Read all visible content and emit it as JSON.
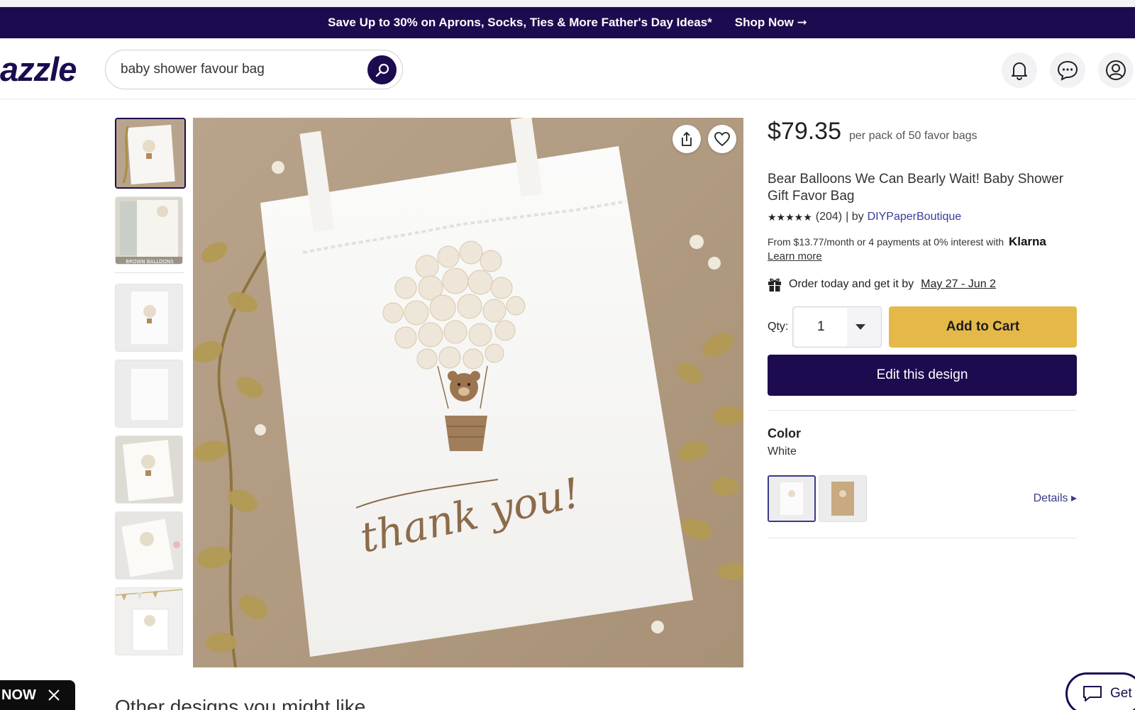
{
  "promo": {
    "text": "Save Up to 30% on Aprons, Socks, Ties & More Father's Day Ideas*",
    "shop_label": "Shop Now ➞"
  },
  "header": {
    "logo": "azzle",
    "search": {
      "value": "baby shower favour bag"
    },
    "icons": [
      "bell-icon",
      "chat-icon",
      "account-icon"
    ]
  },
  "gallery": {
    "thumbnail_count": 7,
    "active_index": 0,
    "thumb2_caption": "BROWN BALLOONS"
  },
  "product_image": {
    "script_text": "thank you!"
  },
  "product": {
    "price": "$79.35",
    "price_note": "per pack of 50 favor bags",
    "title": "Bear Balloons We Can Bearly Wait! Baby Shower Gift Favor Bag",
    "stars": "★★★★★",
    "review_count": "(204)",
    "by_label": "| by",
    "seller": "DIYPaperBoutique",
    "klarna_text": "From $13.77/month or 4 payments at 0% interest with",
    "klarna_logo": "Klarna",
    "learn_more": "Learn more",
    "delivery_text": "Order today and get it by",
    "delivery_date": "May 27 - Jun 2",
    "qty_label": "Qty:",
    "qty_value": "1",
    "add_to_cart": "Add to Cart",
    "edit_design": "Edit this design",
    "color_title": "Color",
    "color_value": "White",
    "details_label": "Details ▸"
  },
  "footer": {
    "section_title": "Other designs you might like",
    "now_badge": "NOW",
    "get_label": "Get"
  },
  "colors": {
    "brand": "#1d0b4f",
    "cart": "#e5b949",
    "backdrop": "#b49f87"
  }
}
